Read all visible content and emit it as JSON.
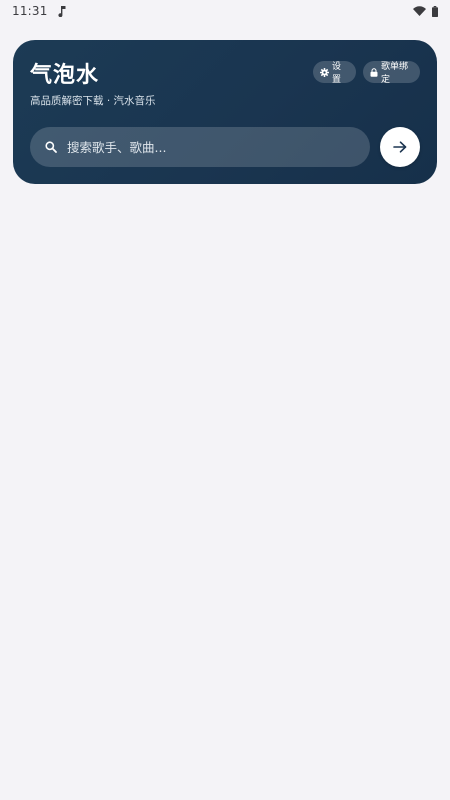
{
  "status_bar": {
    "time": "11:31",
    "icons": [
      "music-note-icon",
      "wifi-icon",
      "battery-icon"
    ]
  },
  "header": {
    "title": "气泡水",
    "subtitle": "高品质解密下载 · 汽水音乐",
    "settings_label": "设置",
    "bind_label": "歌单绑定",
    "background_color": "#1a3550"
  },
  "search": {
    "placeholder": "搜索歌手、歌曲...",
    "value": ""
  },
  "icons": {
    "settings": "gear-icon",
    "bind": "lock-icon",
    "search": "search-icon",
    "go": "arrow-right-icon"
  }
}
